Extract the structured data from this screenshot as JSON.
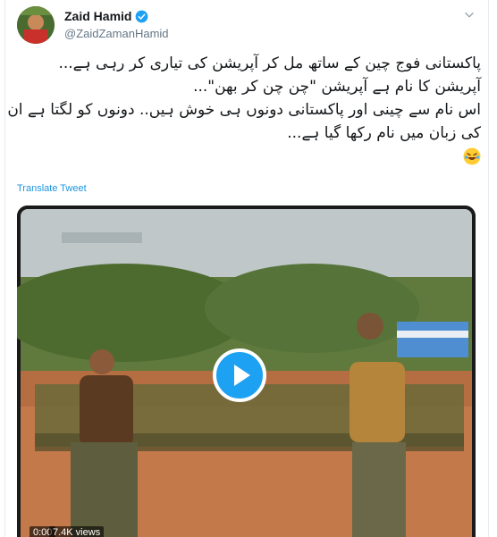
{
  "user": {
    "display_name": "Zaid Hamid",
    "handle": "@ZaidZamanHamid",
    "verified": true,
    "verified_color": "#1da1f2"
  },
  "icons": {
    "verified": "verified-badge-icon",
    "caret": "chevron-down-icon",
    "play": "play-icon",
    "emoji": "rolling-laughing-emoji"
  },
  "tweet": {
    "lines": [
      "پاکستانی فوج چین کے ساتھ مل کر آپریشن کی تیاری کر رہی ہے...",
      "آپریشن کا نام ہے آپریشن \"چن چن کر بھن\"...",
      "اس نام سے چینی اور پاکستانی دونوں ہی خوش ہیں.. دونوں کو لگتا ہے ان",
      "کی زبان میں نام رکھا گیا ہے..."
    ],
    "emoji": "🤣",
    "translate_label": "Translate Tweet"
  },
  "video": {
    "time": "0:00",
    "views": "7.4K views",
    "accent_color": "#1da1f2"
  }
}
